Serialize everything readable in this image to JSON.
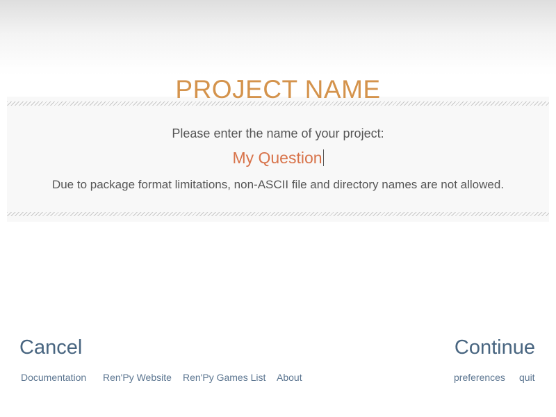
{
  "screen": {
    "title": "PROJECT NAME",
    "prompt": "Please enter the name of your project:",
    "input_value": "My Question",
    "note": "Due to package format limitations, non-ASCII file and directory names are not allowed."
  },
  "actions": {
    "cancel": "Cancel",
    "continue": "Continue"
  },
  "footer": {
    "links": [
      "Documentation",
      "Ren'Py Website",
      "Ren'Py Games List",
      "About"
    ],
    "right": [
      "preferences",
      "quit"
    ]
  },
  "colors": {
    "title": "#d4934c",
    "input": "#d8734a",
    "button": "#486580"
  }
}
